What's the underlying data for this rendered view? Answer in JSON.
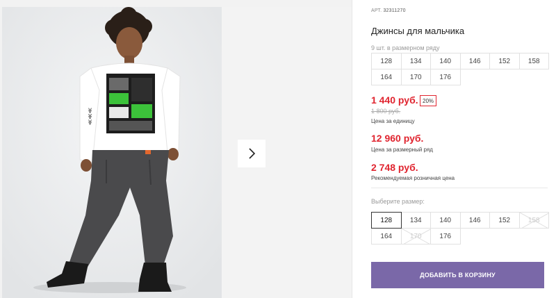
{
  "product": {
    "article_label": "АРТ.",
    "article_number": "32311270",
    "title": "Джинсы для мальчика"
  },
  "gallery": {
    "main_image": "boy-in-white-longsleeve-and-grey-jeans",
    "next_icon": "chevron-right-icon"
  },
  "size_series": {
    "note": "9 шт. в размерном ряду",
    "sizes": [
      "128",
      "134",
      "140",
      "146",
      "152",
      "158",
      "164",
      "170",
      "176"
    ]
  },
  "pricing": {
    "unit_price": "1 440 руб.",
    "discount": "20%",
    "old_price": "1 800 руб.",
    "unit_label": "Цена за единицу",
    "series_price": "12 960 руб.",
    "series_label": "Цена за размерный ряд",
    "retail_price": "2 748 руб.",
    "retail_label": "Рекомендуемая розничная цена"
  },
  "size_picker": {
    "label": "Выберите размер:",
    "options": [
      {
        "size": "128",
        "state": "selected"
      },
      {
        "size": "134",
        "state": "available"
      },
      {
        "size": "140",
        "state": "available"
      },
      {
        "size": "146",
        "state": "available"
      },
      {
        "size": "152",
        "state": "available"
      },
      {
        "size": "158",
        "state": "disabled"
      },
      {
        "size": "164",
        "state": "available"
      },
      {
        "size": "170",
        "state": "disabled"
      },
      {
        "size": "176",
        "state": "available"
      }
    ]
  },
  "actions": {
    "add_to_cart": "ДОБАВИТЬ В КОРЗИНУ"
  },
  "colors": {
    "accent_price": "#e0242f",
    "cart_button": "#7a68a8"
  }
}
